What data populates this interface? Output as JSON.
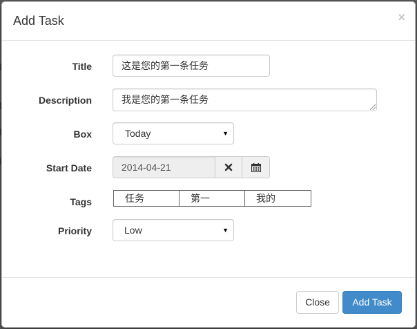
{
  "modal": {
    "title": "Add Task",
    "close_symbol": "×"
  },
  "form": {
    "title_label": "Title",
    "title_value": "这是您的第一条任务",
    "description_label": "Description",
    "description_value": "我是您的第一条任务",
    "box_label": "Box",
    "box_value": "Today",
    "start_date_label": "Start Date",
    "start_date_value": "2014-04-21",
    "tags_label": "Tags",
    "tags": [
      "任务",
      "第一",
      "我的"
    ],
    "priority_label": "Priority",
    "priority_value": "Low"
  },
  "footer": {
    "close_label": "Close",
    "add_label": "Add Task"
  },
  "icons": {
    "clear": "times-icon",
    "calendar": "calendar-icon",
    "select_arrow": "caret-down-icon"
  },
  "colors": {
    "primary": "#428bca",
    "primary_border": "#357ebd",
    "backdrop": "#5c5c5c"
  }
}
